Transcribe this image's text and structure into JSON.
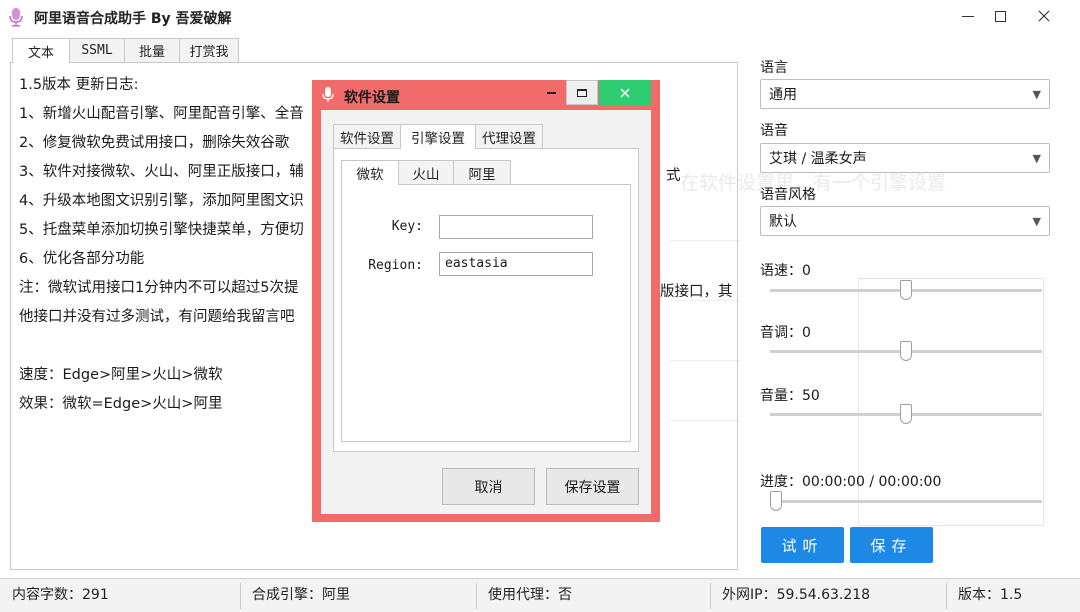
{
  "app": {
    "title": "阿里语音合成助手 By 吾爱破解"
  },
  "main_tabs": [
    {
      "label": "文本",
      "active": true
    },
    {
      "label": "SSML",
      "active": false
    },
    {
      "label": "批量",
      "active": false
    },
    {
      "label": "打赏我",
      "active": false
    }
  ],
  "text_lines": [
    "1.5版本 更新日志:",
    "1、新增火山配音引擎、阿里配音引擎、全音",
    "2、修复微软免费试用接口，删除失效谷歌",
    "3、软件对接微软、火山、阿里正版接口，辅",
    "4、升级本地图文识别引擎，添加阿里图文识",
    "5、托盘菜单添加切换引擎快捷菜单，方便切",
    "6、优化各部分功能",
    "注：微软试用接口1分钟内不可以超过5次提",
    "他接口并没有过多测试，有问题给我留言吧",
    "",
    "速度：Edge>阿里>火山>微软",
    "效果：微软=Edge>火山>阿里"
  ],
  "text_overflow_right": {
    "line3_tail": "式",
    "line8_tail": "版接口，其"
  },
  "right_panel": {
    "language_label": "语言",
    "language_value": "通用",
    "voice_label": "语音",
    "voice_value": "艾琪 / 温柔女声",
    "style_label": "语音风格",
    "style_value": "默认",
    "speed_label": "语速：0",
    "speed_value": 0,
    "pitch_label": "音调：0",
    "pitch_value": 0,
    "volume_label": "音量：50",
    "volume_value": 50,
    "progress_label": "进度：00:00:00 / 00:00:00",
    "progress_value": 0,
    "listen_button": "试听",
    "save_button": "保存"
  },
  "status_bar": {
    "char_count": "内容字数：291",
    "engine": "合成引擎：阿里",
    "proxy": "使用代理：否",
    "ip": "外网IP：59.54.63.218",
    "version": "版本：1.5"
  },
  "dialog": {
    "title": "软件设置",
    "tabs": [
      {
        "label": "软件设置",
        "active": false
      },
      {
        "label": "引擎设置",
        "active": true
      },
      {
        "label": "代理设置",
        "active": false
      }
    ],
    "sub_tabs": [
      {
        "label": "微软",
        "active": true
      },
      {
        "label": "火山",
        "active": false
      },
      {
        "label": "阿里",
        "active": false
      }
    ],
    "key_label": "Key:",
    "key_value": "",
    "region_label": "Region:",
    "region_value": "eastasia",
    "cancel_button": "取消",
    "save_button": "保存设置"
  },
  "background_ghost_text": "在软件设置里，有一个引擎设置",
  "colors": {
    "accent_blue": "#1e88e5",
    "dialog_frame": "#f26b6b",
    "close_green": "#2ecc71",
    "mic_icon": "#d88fd8"
  },
  "icons": {
    "app": "microphone-icon",
    "minimize": "minimize-icon",
    "maximize": "maximize-icon",
    "close": "close-icon"
  }
}
